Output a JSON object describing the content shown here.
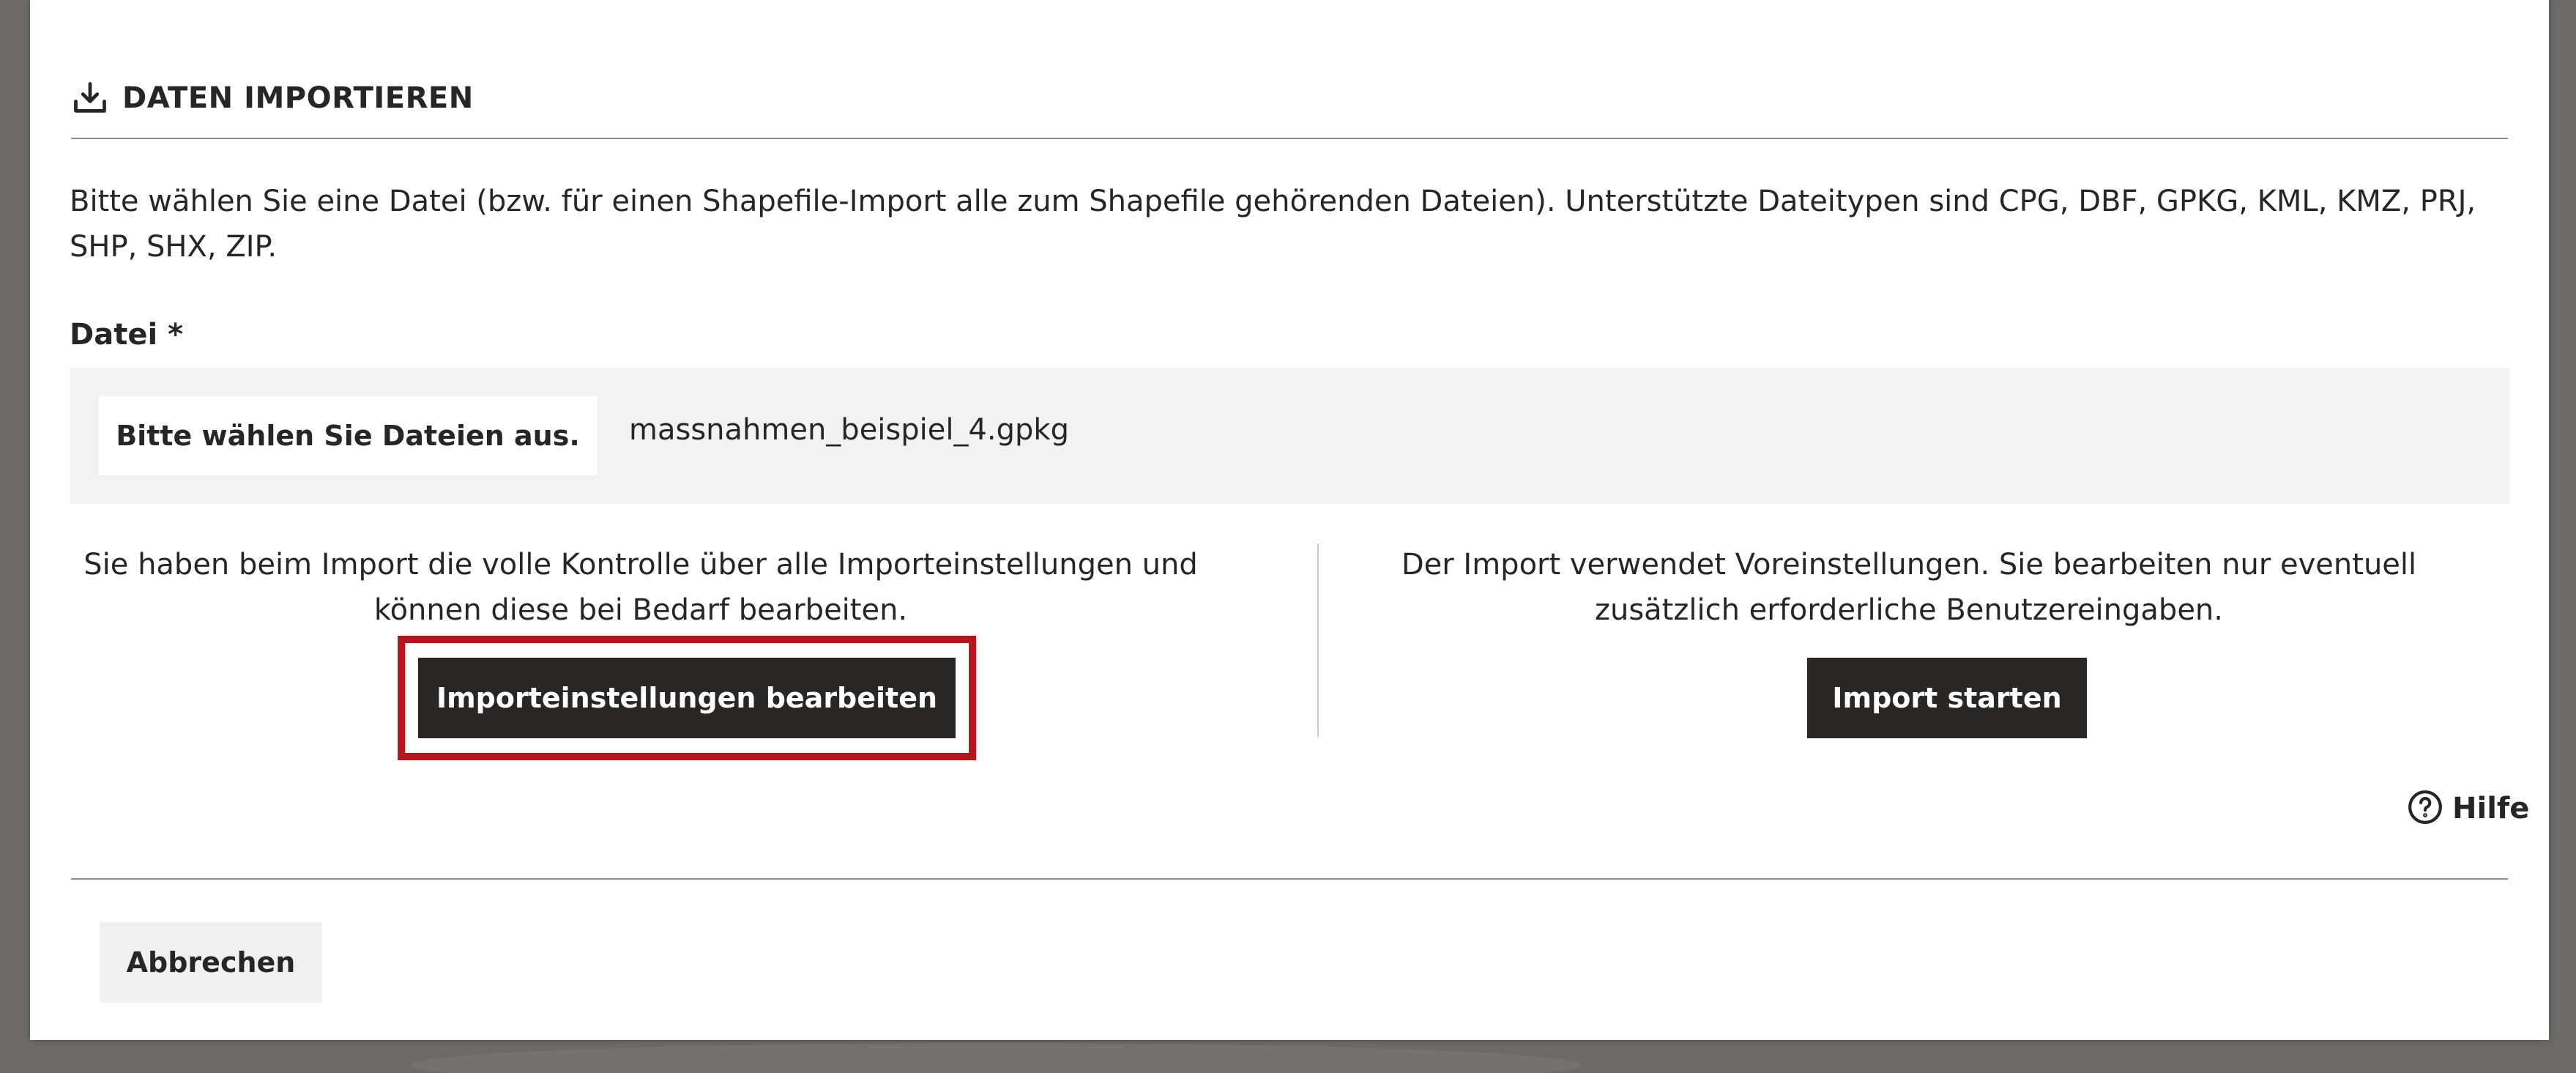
{
  "dialog": {
    "title": "DATEN IMPORTIEREN",
    "intro": "Bitte wählen Sie eine Datei (bzw. für einen Shapefile-Import alle zum Shapefile gehörenden Dateien). Unterstützte Dateitypen sind CPG, DBF, GPKG, KML, KMZ, PRJ, SHP, SHX, ZIP.",
    "file_field": {
      "label": "Datei *",
      "button_label": "Bitte wählen Sie Dateien aus.",
      "selected_file": "massnahmen_beispiel_4.gpkg"
    },
    "options": {
      "full_control": {
        "description": "Sie haben beim Import die volle Kontrolle über alle Importeinstellungen und können diese bei Bedarf bearbeiten.",
        "button_label": "Importeinstellungen bearbeiten"
      },
      "defaults": {
        "description": "Der Import verwendet Voreinstellungen. Sie bearbeiten nur eventuell zusätzlich erforderliche Benutzereingaben.",
        "button_label": "Import starten"
      }
    },
    "help_label": "Hilfe",
    "cancel_label": "Abbrechen"
  },
  "colors": {
    "overlay": "#6d6a66",
    "dialog_bg": "#ffffff",
    "dark_button": "#2a2624",
    "highlight": "#b8141b",
    "file_box_bg": "#f2f2f2"
  },
  "icons": {
    "header": "import-download-icon",
    "help": "question-circle-icon"
  }
}
